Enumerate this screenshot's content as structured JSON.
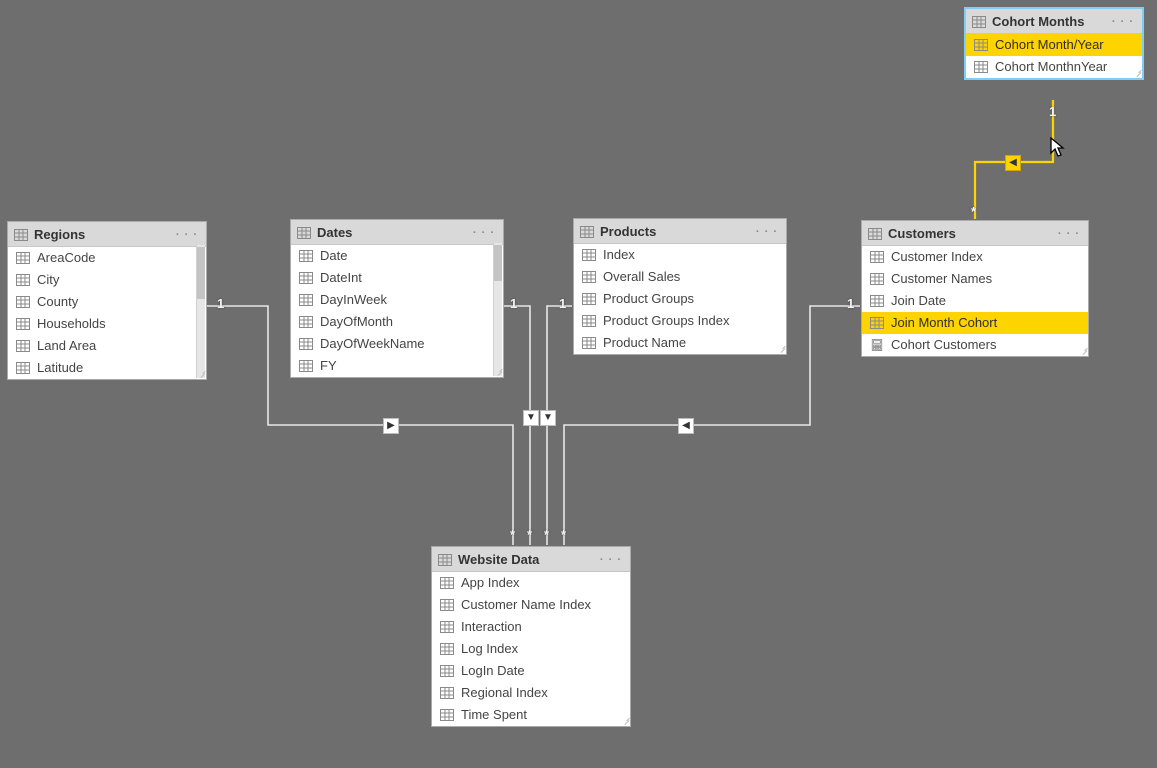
{
  "tables": {
    "regions": {
      "title": "Regions",
      "fields": [
        "AreaCode",
        "City",
        "County",
        "Households",
        "Land Area",
        "Latitude"
      ]
    },
    "dates": {
      "title": "Dates",
      "fields": [
        "Date",
        "DateInt",
        "DayInWeek",
        "DayOfMonth",
        "DayOfWeekName",
        "FY"
      ]
    },
    "products": {
      "title": "Products",
      "fields": [
        "Index",
        "Overall Sales",
        "Product Groups",
        "Product Groups Index",
        "Product Name"
      ]
    },
    "customers": {
      "title": "Customers",
      "fields": [
        "Customer Index",
        "Customer Names",
        "Join Date",
        "Join Month Cohort",
        "Cohort Customers"
      ],
      "key_index": 3,
      "calc_index": 4
    },
    "website": {
      "title": "Website Data",
      "fields": [
        "App Index",
        "Customer Name Index",
        "Interaction",
        "Log Index",
        "LogIn Date",
        "Regional Index",
        "Time Spent"
      ]
    },
    "cohort": {
      "title": "Cohort Months",
      "fields": [
        "Cohort Month/Year",
        "Cohort MonthnYear"
      ],
      "key_index": 0
    }
  },
  "menu_dots": "· · ·",
  "cardinality": {
    "one": "1",
    "many": "*"
  }
}
